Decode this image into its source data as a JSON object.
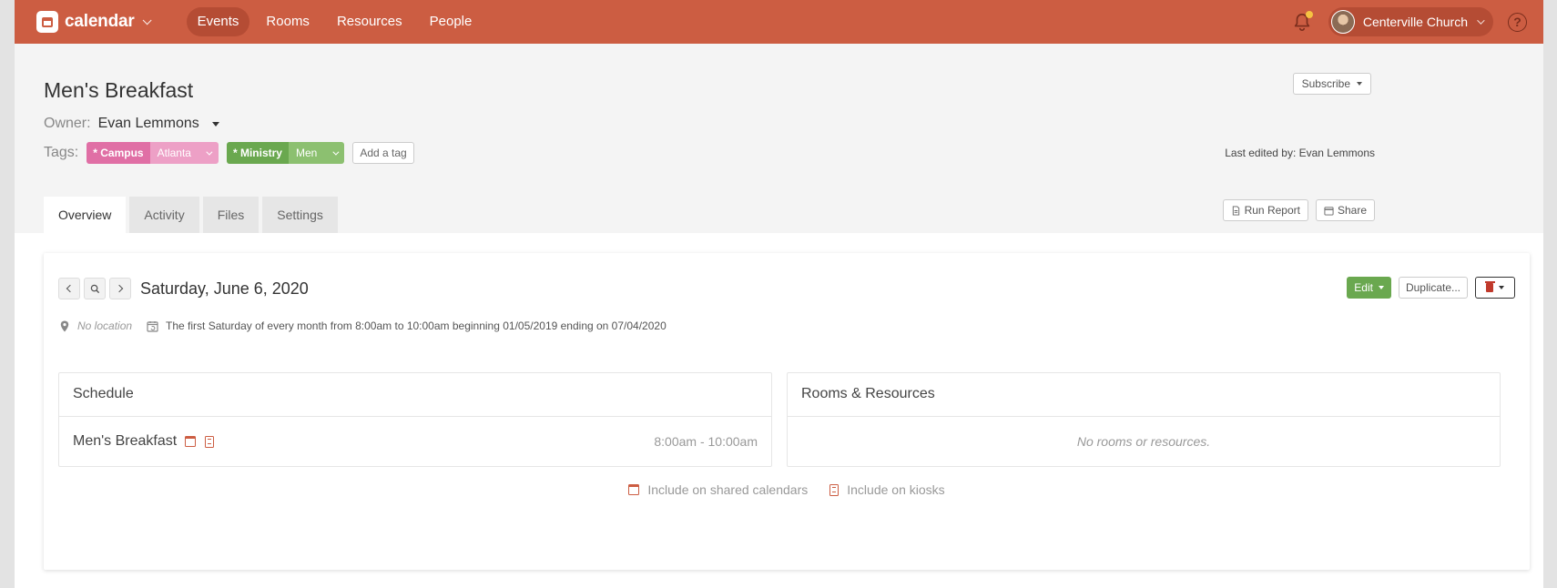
{
  "nav": {
    "app_name": "calendar",
    "links": [
      {
        "label": "Events",
        "active": true
      },
      {
        "label": "Rooms",
        "active": false
      },
      {
        "label": "Resources",
        "active": false
      },
      {
        "label": "People",
        "active": false
      }
    ],
    "org_name": "Centerville Church",
    "help": "?"
  },
  "event": {
    "title": "Men's Breakfast",
    "owner_label": "Owner:",
    "owner_name": "Evan Lemmons",
    "tags_label": "Tags:",
    "tags": [
      {
        "key": "* Campus",
        "value": "Atlanta"
      },
      {
        "key": "* Ministry",
        "value": "Men"
      }
    ],
    "add_tag": "Add a tag",
    "subscribe": "Subscribe",
    "last_edited": "Last edited by: Evan Lemmons"
  },
  "tabs": [
    {
      "label": "Overview",
      "active": true
    },
    {
      "label": "Activity",
      "active": false
    },
    {
      "label": "Files",
      "active": false
    },
    {
      "label": "Settings",
      "active": false
    }
  ],
  "tab_actions": {
    "run_report": "Run Report",
    "share": "Share"
  },
  "occurrence": {
    "date": "Saturday, June 6, 2020",
    "edit": "Edit",
    "duplicate": "Duplicate...",
    "location": "No location",
    "recurrence": "The first Saturday of every month from 8:00am to 10:00am beginning 01/05/2019 ending on 07/04/2020"
  },
  "schedule": {
    "heading": "Schedule",
    "item_name": "Men's Breakfast",
    "item_time": "8:00am - 10:00am"
  },
  "rooms": {
    "heading": "Rooms & Resources",
    "empty": "No rooms or resources."
  },
  "legend": {
    "shared": "Include on shared calendars",
    "kiosks": "Include on kiosks"
  },
  "colors": {
    "brand": "#cc5d42",
    "campus_tag": "#e06fa5",
    "ministry_tag": "#6aa84f",
    "edit_button": "#6aa84f"
  }
}
